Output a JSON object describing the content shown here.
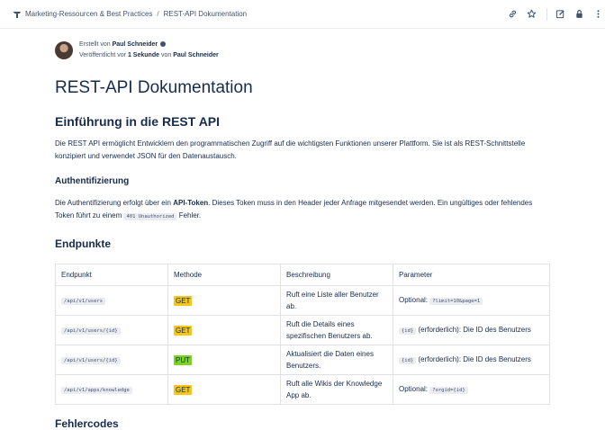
{
  "breadcrumb": {
    "space": "Marketing-Ressourcen & Best Practices",
    "separator": "/",
    "page": "REST-API Dokumentation"
  },
  "byline": {
    "created_prefix": "Erstellt von",
    "author": "Paul Schneider",
    "published_prefix": "Veröffentlicht vor",
    "published_time": "1 Sekunde",
    "published_by": "von",
    "publisher": "Paul Schneider"
  },
  "title": "REST-API Dokumentation",
  "intro": {
    "heading": "Einführung in die REST API",
    "text": "Die REST API ermöglicht Entwicklern den programmatischen Zugriff auf die wichtigsten Funktionen unserer Plattform. Sie ist als REST-Schnittstelle konzipiert und verwendet JSON für den Datenaustausch."
  },
  "auth": {
    "heading": "Authentifizierung",
    "text_before": "Die Authentifizierung erfolgt über ein ",
    "token": "API-Token",
    "text_middle": ". Dieses Token muss in den Header jeder Anfrage mitgesendet werden. Ein ungültiges oder fehlendes Token führt zu einem ",
    "code": "401 Unauthorized",
    "text_after": " Fehler."
  },
  "endpoints": {
    "heading": "Endpunkte",
    "columns": [
      "Endpunkt",
      "Methode",
      "Beschreibung",
      "Parameter"
    ],
    "rows": [
      {
        "endpoint": "/api/v1/users",
        "method": "GET",
        "description": "Ruft eine Liste aller Benutzer ab.",
        "param_text": "Optional: ",
        "param_code": "?limit=10&page=1",
        "param_after": ""
      },
      {
        "endpoint": "/api/v1/users/{id}",
        "method": "GET",
        "description": "Ruft die Details eines spezifischen Benutzers ab.",
        "param_text": "",
        "param_code": "{id}",
        "param_after": " (erforderlich): Die ID des Benutzers"
      },
      {
        "endpoint": "/api/v1/users/{id}",
        "method": "PUT",
        "description": "Aktualisiert die Daten eines Benutzers.",
        "param_text": "",
        "param_code": "{id}",
        "param_after": " (erforderlich): Die ID des Benutzers"
      },
      {
        "endpoint": "/api/v1/apps/knowledge",
        "method": "GET",
        "description": "Ruft alle Wikis der Knowledge App ab.",
        "param_text": "Optional: ",
        "param_code": "?orgid={id}",
        "param_after": ""
      }
    ]
  },
  "next_heading": "Fehlercodes",
  "colors": {
    "get": "#f5c518",
    "put": "#7bd321",
    "text": "#172b4d"
  },
  "icons": [
    "space-icon",
    "link-icon",
    "star-icon",
    "edit-icon",
    "lock-icon",
    "more-icon"
  ]
}
